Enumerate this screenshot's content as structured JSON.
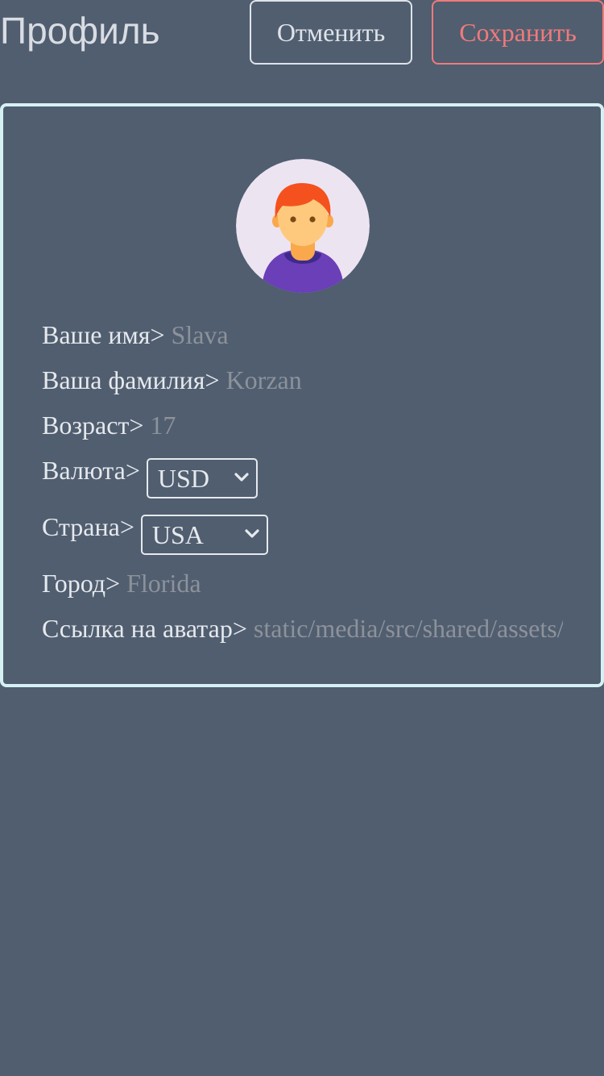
{
  "header": {
    "title": "Профиль",
    "cancel_label": "Отменить",
    "save_label": "Сохранить"
  },
  "profile": {
    "avatar_icon": "user-avatar-icon",
    "fields": {
      "first_name": {
        "label": "Ваше имя>",
        "value": "Slava"
      },
      "last_name": {
        "label": "Ваша фамилия>",
        "value": "Korzan"
      },
      "age": {
        "label": "Возраст>",
        "value": "17"
      },
      "currency": {
        "label": "Валюта>",
        "selected": "USD"
      },
      "country": {
        "label": "Страна>",
        "selected": "USA"
      },
      "city": {
        "label": "Город>",
        "value": "Florida"
      },
      "avatar_link": {
        "label": "Ссылка на аватар>",
        "value": "static/media/src/shared/assets/"
      }
    }
  },
  "colors": {
    "background": "#505e70",
    "card_border": "#d6f1f4",
    "save_accent": "#f07a7a",
    "text_primary": "#e6e9ed",
    "text_value": "#8d929a"
  }
}
